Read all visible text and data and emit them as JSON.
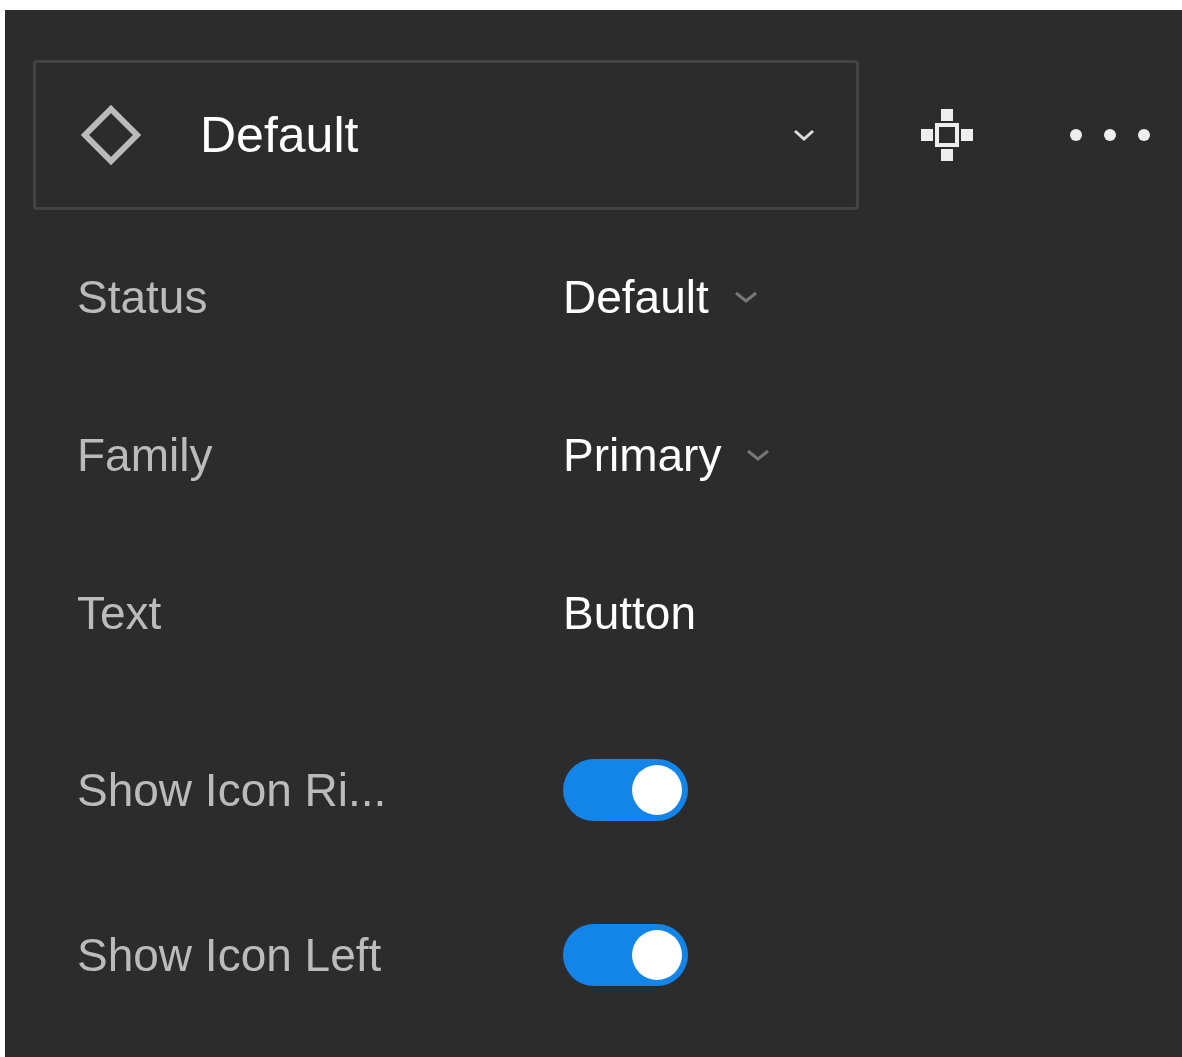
{
  "component": {
    "name": "Default"
  },
  "properties": [
    {
      "kind": "dropdown",
      "label": "Status",
      "value": "Default"
    },
    {
      "kind": "dropdown",
      "label": "Family",
      "value": "Primary"
    },
    {
      "kind": "text",
      "label": "Text",
      "value": "Button"
    },
    {
      "kind": "toggle",
      "label": "Show Icon Ri...",
      "on": true
    },
    {
      "kind": "toggle",
      "label": "Show Icon Left",
      "on": true
    }
  ]
}
